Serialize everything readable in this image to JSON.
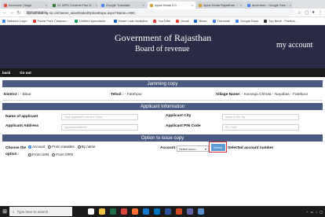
{
  "browser": {
    "tabs": [
      {
        "title": "Accounts | Sage",
        "color": "#e74c3c",
        "active": false
      },
      {
        "title": "XL WPX Content Plan D...",
        "color": "#2e7d32",
        "active": false
      },
      {
        "title": "Google Translate",
        "color": "#4285f4",
        "active": false
      },
      {
        "title": "Apna Khata 3.0",
        "color": "#c9a227",
        "active": true
      },
      {
        "title": "Apna Khata Rajasthan ...",
        "color": "#c9a227",
        "active": false
      },
      {
        "title": "accenture - Google Sea...",
        "color": "#4285f4",
        "active": false
      }
    ],
    "url_label": "Not secure",
    "url": "apnakhata.raj.nic.in/Owner_wise/NakalOptionExpo.aspx?Name=ABC",
    "bookmarks": [
      {
        "label": "Network Login",
        "color": "#4285f4"
      },
      {
        "label": "Facial Pore Cleanser...",
        "color": "#e53935"
      },
      {
        "label": "Untitled spreadshe...",
        "color": "#0f9d58"
      },
      {
        "label": "Home Loan Analytics",
        "color": "#1565c0"
      },
      {
        "label": "YouTube",
        "color": "#e53935"
      },
      {
        "label": "Gmail",
        "color": "#ea4335"
      },
      {
        "label": "News",
        "color": "#1565c0"
      },
      {
        "label": "Translate",
        "color": "#4285f4"
      },
      {
        "label": "Google Docs",
        "color": "#4285f4"
      },
      {
        "label": "Top Bank - Publica...",
        "color": "#333333"
      }
    ]
  },
  "header": {
    "gov_title": "Government of Rajasthan",
    "board_title": "Board of revenue",
    "account_title": "my account"
  },
  "menu": {
    "back": "back",
    "logout": "Go out"
  },
  "jamabandi": {
    "heading": "Jamming copy",
    "district_label": "District : ",
    "district_value": "- Bikar",
    "tehsil_label": "Tehsil : ",
    "tehsil_value": "- Fatehpur",
    "village_label": "Village Name: ",
    "village_value": "- Karanga Chhota - Nayabas - Fatehpur"
  },
  "applicant": {
    "heading": "Applicant Information",
    "name_label": "Name of applicant",
    "name_placeholder": "Type applicant's name in Hindi",
    "city_label": "Applicant City",
    "city_placeholder": "name of the city",
    "address_label": "Applicant Address",
    "address_placeholder": "Applicant Address",
    "pin_label": "Applicant PIN Code",
    "pin_placeholder": "Pin Code"
  },
  "issue": {
    "heading": "Option to issue copy",
    "choose_label_1": "Choose the",
    "choose_label_2": "option :",
    "options": [
      {
        "label": "Account",
        "selected": true
      },
      {
        "label": "From measles",
        "selected": false
      },
      {
        "label": "By name",
        "selected": false
      },
      {
        "label": "From USN",
        "selected": false
      },
      {
        "label": "From ORN",
        "selected": false
      }
    ],
    "account_number_label": "Account Number",
    "account_select_value": "Select acco...",
    "select_button": "Select",
    "selected_account_label": "Selected account number"
  },
  "taskbar": {
    "search_placeholder": "Type here to search",
    "apps": [
      {
        "name": "task-view",
        "color": "#ffffff"
      },
      {
        "name": "file-explorer",
        "color": "#f4c542"
      },
      {
        "name": "excel",
        "color": "#1e7145"
      },
      {
        "name": "chrome",
        "color": "#db4437"
      },
      {
        "name": "firefox",
        "color": "#ff7139"
      },
      {
        "name": "edge",
        "color": "#0f78d4"
      },
      {
        "name": "outlook",
        "color": "#0072c6"
      },
      {
        "name": "word",
        "color": "#2b579a"
      },
      {
        "name": "powerpoint",
        "color": "#d24726"
      },
      {
        "name": "teams",
        "color": "#6264a7"
      },
      {
        "name": "notepad",
        "color": "#5a8fd0"
      }
    ]
  }
}
